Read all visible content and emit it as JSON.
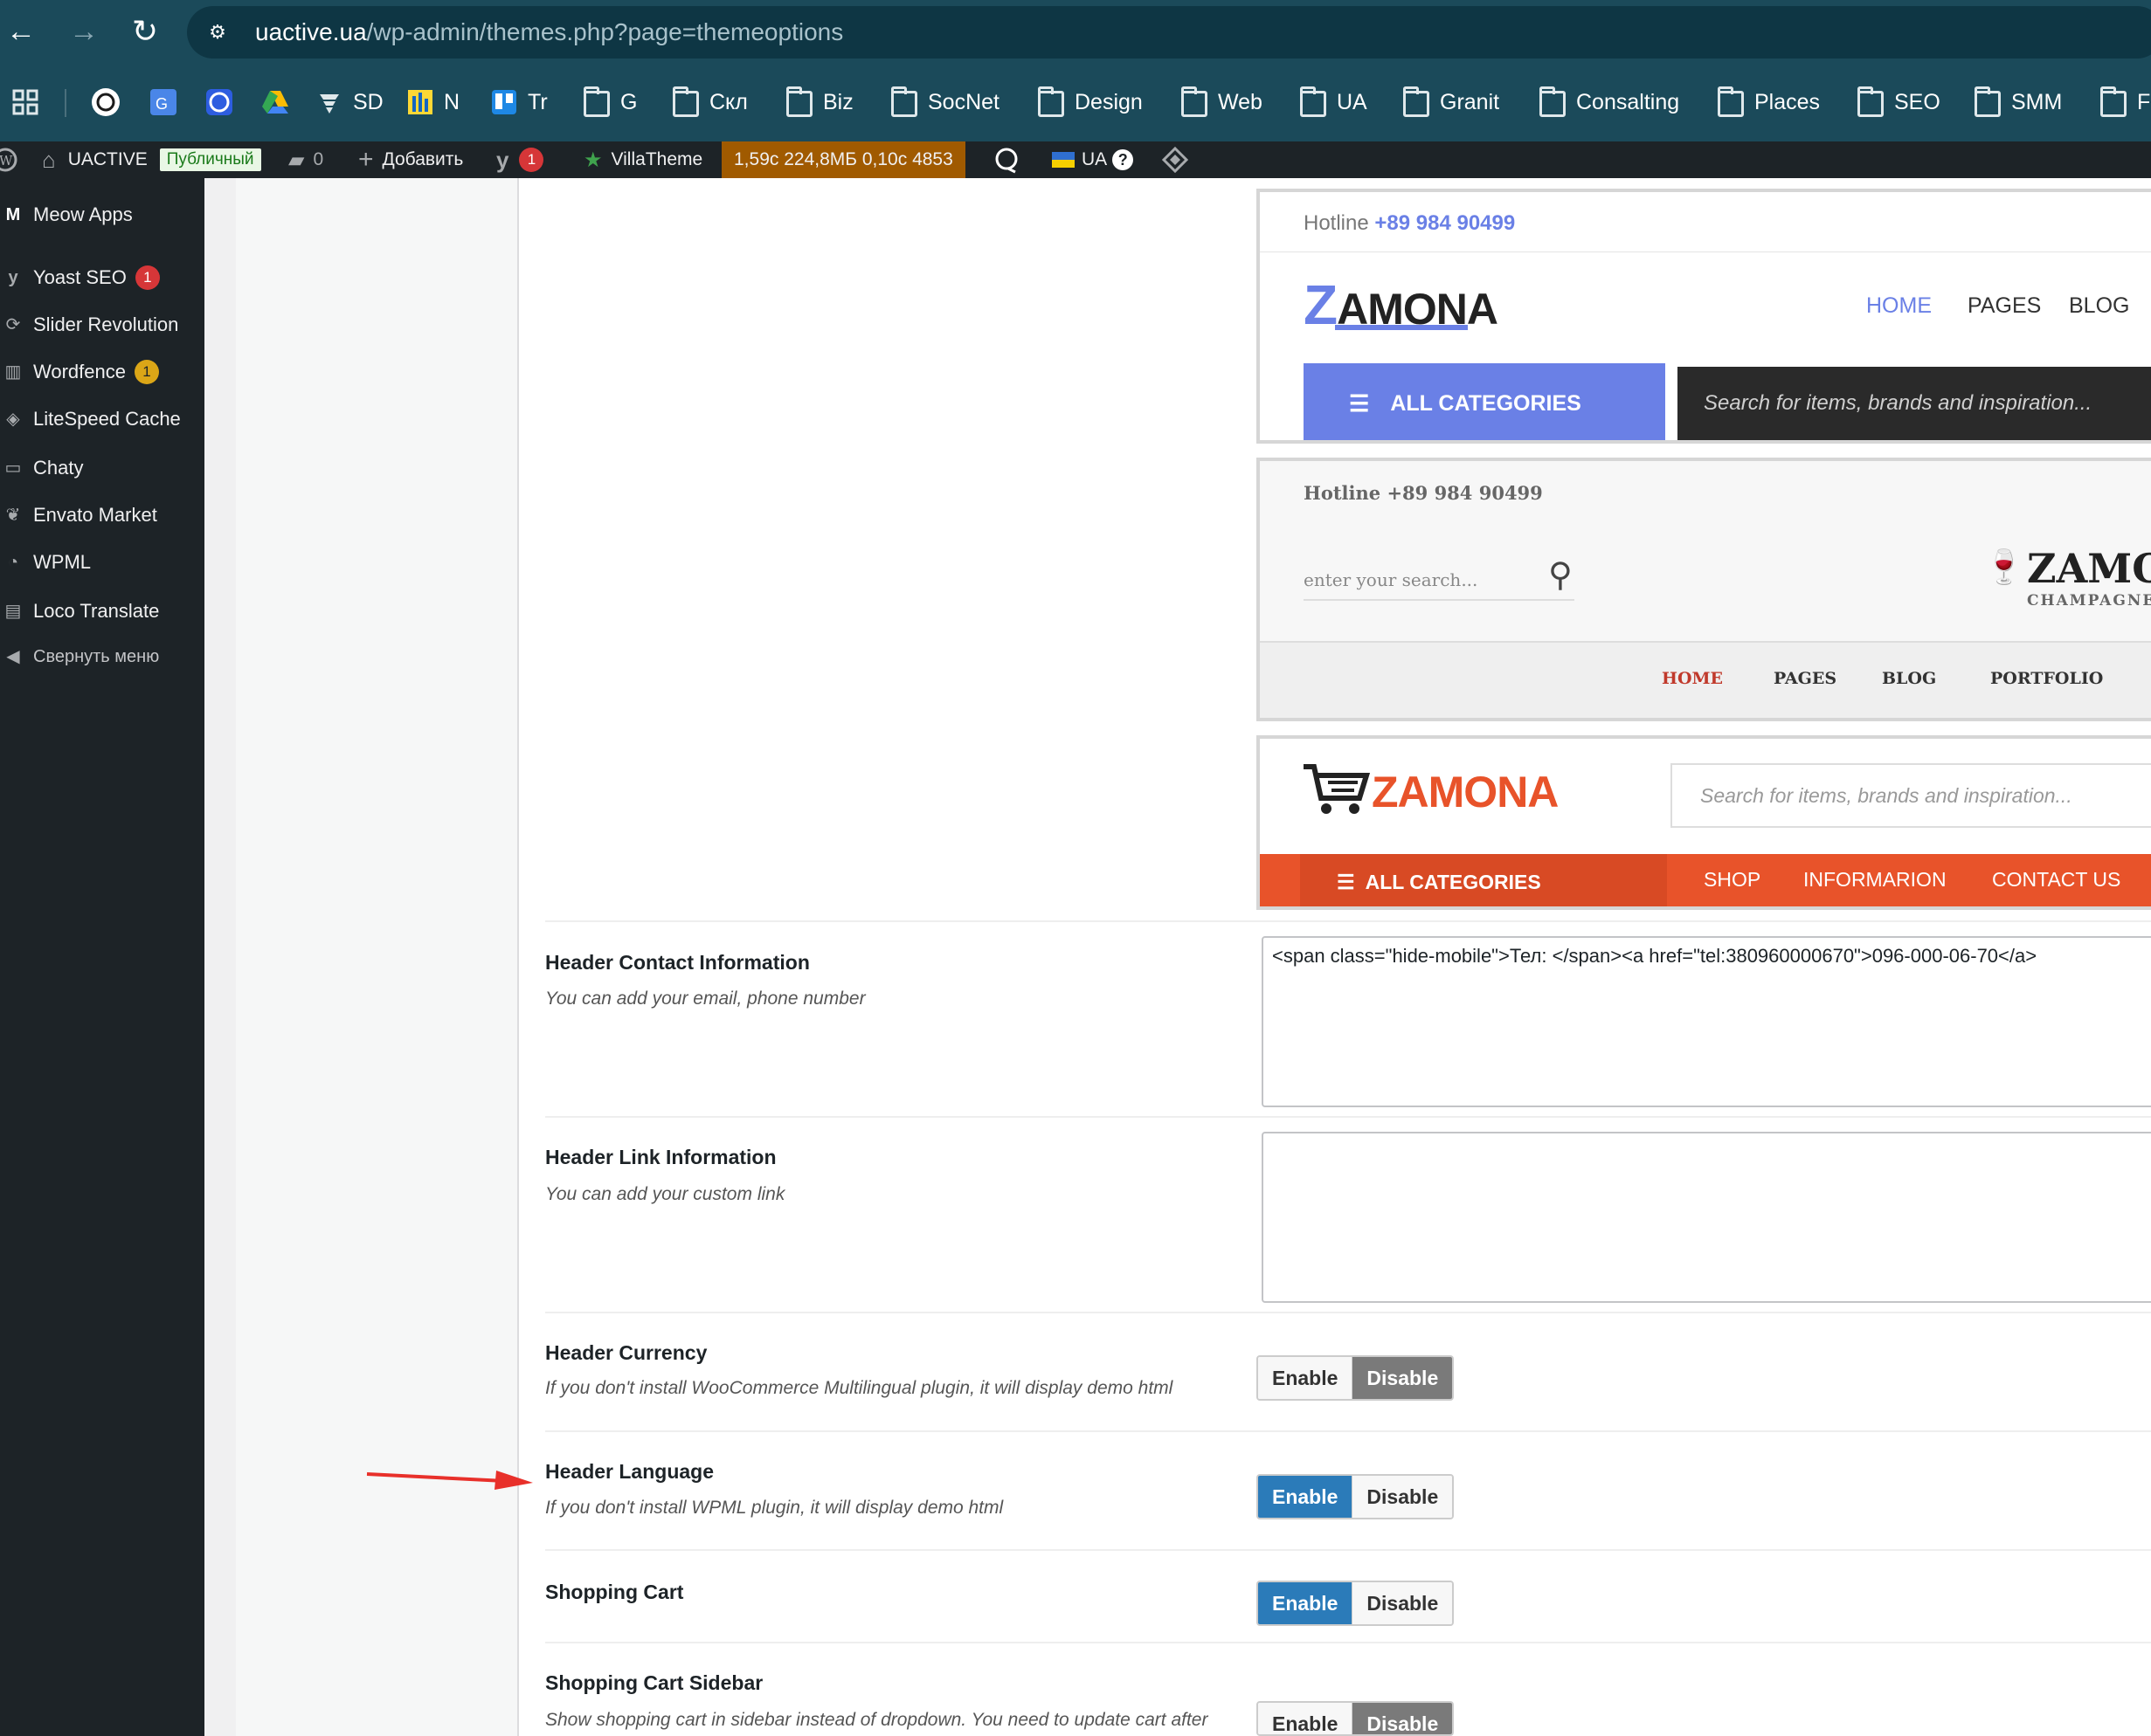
{
  "browser": {
    "url_host": "uactive.ua",
    "url_path": "/wp-admin/themes.php?page=themeoptions"
  },
  "bookmarks": [
    {
      "label": "SD"
    },
    {
      "label": "N"
    },
    {
      "label": "Tr"
    },
    {
      "label": "G"
    },
    {
      "label": "Скл"
    },
    {
      "label": "Biz"
    },
    {
      "label": "SocNet"
    },
    {
      "label": "Design"
    },
    {
      "label": "Web"
    },
    {
      "label": "UA"
    },
    {
      "label": "Granit"
    },
    {
      "label": "Consalting"
    },
    {
      "label": "Places"
    },
    {
      "label": "SEO"
    },
    {
      "label": "SMM"
    },
    {
      "label": "F"
    }
  ],
  "adminbar": {
    "site_name": "UACTIVE",
    "public_badge": "Публичный",
    "comments_count": "0",
    "add_label": "Добавить",
    "yoast_count": "1",
    "villatheme_label": "VillaTheme",
    "perf_stats": "1,59с  224,8МБ  0,10с  4853",
    "lang_label": "UA"
  },
  "sidebar": {
    "items": [
      {
        "label": "Meow Apps"
      },
      {
        "label": "Yoast SEO",
        "badge": "1"
      },
      {
        "label": "Slider Revolution"
      },
      {
        "label": "Wordfence",
        "badge": "1"
      },
      {
        "label": "LiteSpeed Cache"
      },
      {
        "label": "Chaty"
      },
      {
        "label": "Envato Market"
      },
      {
        "label": "WPML"
      },
      {
        "label": "Loco Translate"
      },
      {
        "label": "Свернуть меню"
      }
    ]
  },
  "previews": {
    "p1": {
      "hotline_label": "Hotline",
      "hotline_number": "+89 984 90499",
      "logo_z": "Z",
      "logo_rest": "AMONA",
      "menu": [
        "HOME",
        "PAGES",
        "BLOG"
      ],
      "all_categories": "ALL CATEGORIES",
      "search_placeholder": "Search for items, brands and inspiration..."
    },
    "p2": {
      "hotline": "Hotline +89 984 90499",
      "search_placeholder": "enter your search...",
      "logo": "ZAMON",
      "logo_sub": "CHAMPAGNE PA",
      "menu": [
        "HOME",
        "PAGES",
        "BLOG",
        "PORTFOLIO"
      ]
    },
    "p3": {
      "logo": "ZAMONA",
      "search_placeholder": "Search for items, brands and inspiration...",
      "all_categories": "ALL CATEGORIES",
      "menu": [
        "SHOP",
        "INFORMARION",
        "CONTACT US"
      ]
    }
  },
  "options": {
    "header_contact": {
      "title": "Header Contact Information",
      "desc": "You can add your email, phone number",
      "value": "<span class=\"hide-mobile\">Тел: </span><a href=\"tel:380960000670\">096-000-06-70</a>"
    },
    "header_link": {
      "title": "Header Link Information",
      "desc": "You can add your custom link",
      "value": ""
    },
    "header_currency": {
      "title": "Header Currency",
      "desc": "If you don't install WooCommerce Multilingual plugin, it will display demo html",
      "state": "disable"
    },
    "header_language": {
      "title": "Header Language",
      "desc": "If you don't install WPML plugin, it will display demo html",
      "state": "enable"
    },
    "shopping_cart": {
      "title": "Shopping Cart",
      "state": "enable"
    },
    "shopping_cart_sidebar": {
      "title": "Shopping Cart Sidebar",
      "desc": "Show shopping cart in sidebar instead of dropdown. You need to update cart after",
      "state": "disable"
    },
    "toggle_labels": {
      "enable": "Enable",
      "disable": "Disable"
    }
  },
  "colors": {
    "enable_active": "#2b7bb9",
    "disable_active": "#7a7a7a",
    "annotation_arrow": "#e8302a",
    "preview1_accent": "#6a80e6",
    "preview3_accent": "#e8532a"
  }
}
